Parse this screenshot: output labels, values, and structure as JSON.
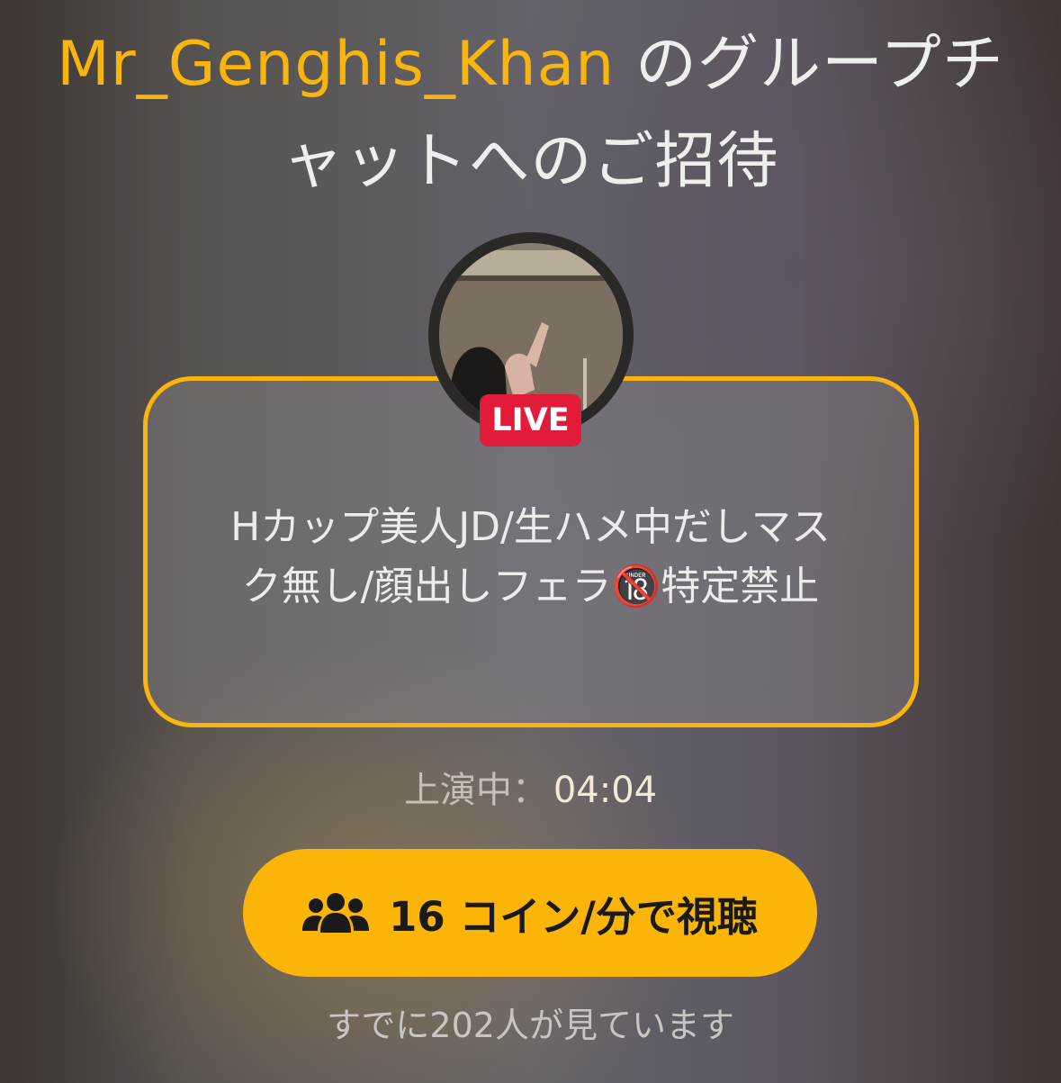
{
  "invite": {
    "host_name": "Mr_Genghis_Khan",
    "title_suffix": " のグループチャットへのご招待"
  },
  "avatar": {
    "icon": "host-avatar-photo",
    "badge_label": "LIVE",
    "badge_color": "#e31b3a"
  },
  "show": {
    "description": "Hカップ美人JD/生ハメ中だしマスク無し/顔出しフェラ🔞特定禁止"
  },
  "timer": {
    "label": "上演中：",
    "value": "04:04"
  },
  "action": {
    "button_label": "16 コイン/分で視聴",
    "button_icon": "group-users-icon",
    "accent_color": "#fbb509"
  },
  "viewers": {
    "text": "すでに202人が見ています"
  }
}
